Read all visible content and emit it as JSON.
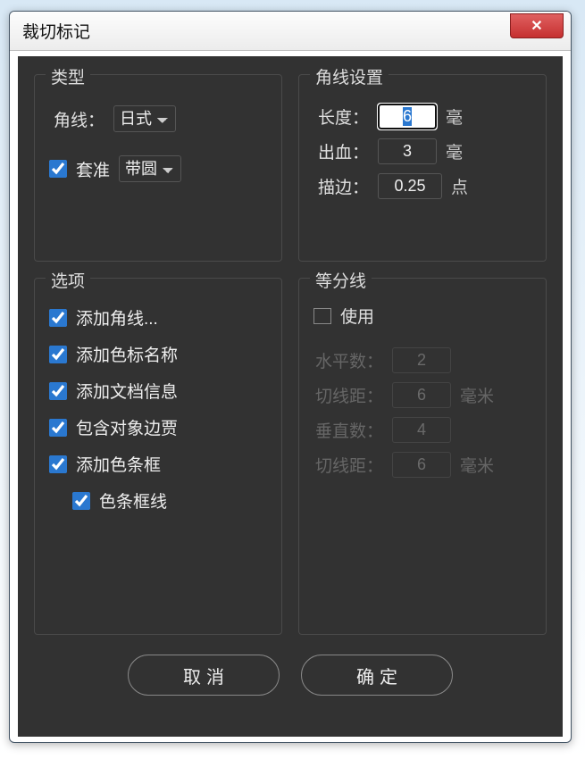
{
  "window": {
    "title": "裁切标记"
  },
  "type_panel": {
    "title": "类型",
    "corner_label": "角线：",
    "corner_value": "日式",
    "register_checked": true,
    "register_label": "套准",
    "register_value": "带圆"
  },
  "corner_settings": {
    "title": "角线设置",
    "length_label": "长度：",
    "length_value": "6",
    "length_unit": "毫",
    "bleed_label": "出血：",
    "bleed_value": "3",
    "bleed_unit": "毫",
    "stroke_label": "描边：",
    "stroke_value": "0.25",
    "stroke_unit": "点"
  },
  "options": {
    "title": "选项",
    "items": [
      {
        "id": "add_corner",
        "label": "添加角线...",
        "checked": true
      },
      {
        "id": "add_swatch_name",
        "label": "添加色标名称",
        "checked": true
      },
      {
        "id": "add_doc_info",
        "label": "添加文档信息",
        "checked": true
      },
      {
        "id": "include_obj_bbox",
        "label": "包含对象边贾",
        "checked": true
      },
      {
        "id": "add_color_bar",
        "label": "添加色条框",
        "checked": true
      },
      {
        "id": "color_bar_line",
        "label": "色条框线",
        "checked": true,
        "indent": true
      }
    ]
  },
  "division": {
    "title": "等分线",
    "use_label": "使用",
    "use_checked": false,
    "hcount_label": "水平数：",
    "hcount_value": "2",
    "tangent1_label": "切线距：",
    "tangent1_value": "6",
    "tangent1_unit": "毫米",
    "vcount_label": "垂直数：",
    "vcount_value": "4",
    "tangent2_label": "切线距：",
    "tangent2_value": "6",
    "tangent2_unit": "毫米"
  },
  "buttons": {
    "cancel": "取消",
    "ok": "确定"
  }
}
